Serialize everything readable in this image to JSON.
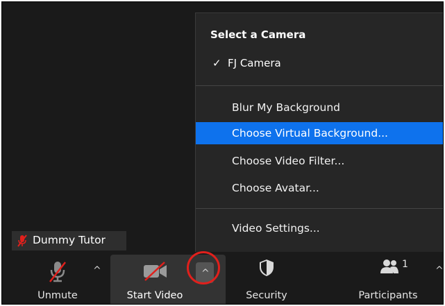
{
  "camera_menu": {
    "heading": "Select a Camera",
    "camera": {
      "check": "✓",
      "label": "FJ Camera"
    },
    "items": [
      {
        "label": "Blur My Background",
        "highlighted": false
      },
      {
        "label": "Choose Virtual Background...",
        "highlighted": true
      },
      {
        "label": "Choose Video Filter...",
        "highlighted": false
      },
      {
        "label": "Choose Avatar...",
        "highlighted": false
      }
    ],
    "settings_label": "Video Settings..."
  },
  "name_tag": {
    "name": "Dummy Tutor",
    "mic_state": "muted"
  },
  "toolbar": {
    "unmute_label": "Unmute",
    "start_video_label": "Start Video",
    "security_label": "Security",
    "participants_label": "Participants",
    "participants_count": "1",
    "caret": "^"
  },
  "colors": {
    "highlight": "#0e72ed",
    "muted_red": "#e0201c",
    "annotation_circle": "#e0201c"
  },
  "icons": [
    "microphone-muted-icon",
    "video-camera-off-icon",
    "shield-icon",
    "participants-icon",
    "chevron-up-icon",
    "checkmark-icon"
  ]
}
